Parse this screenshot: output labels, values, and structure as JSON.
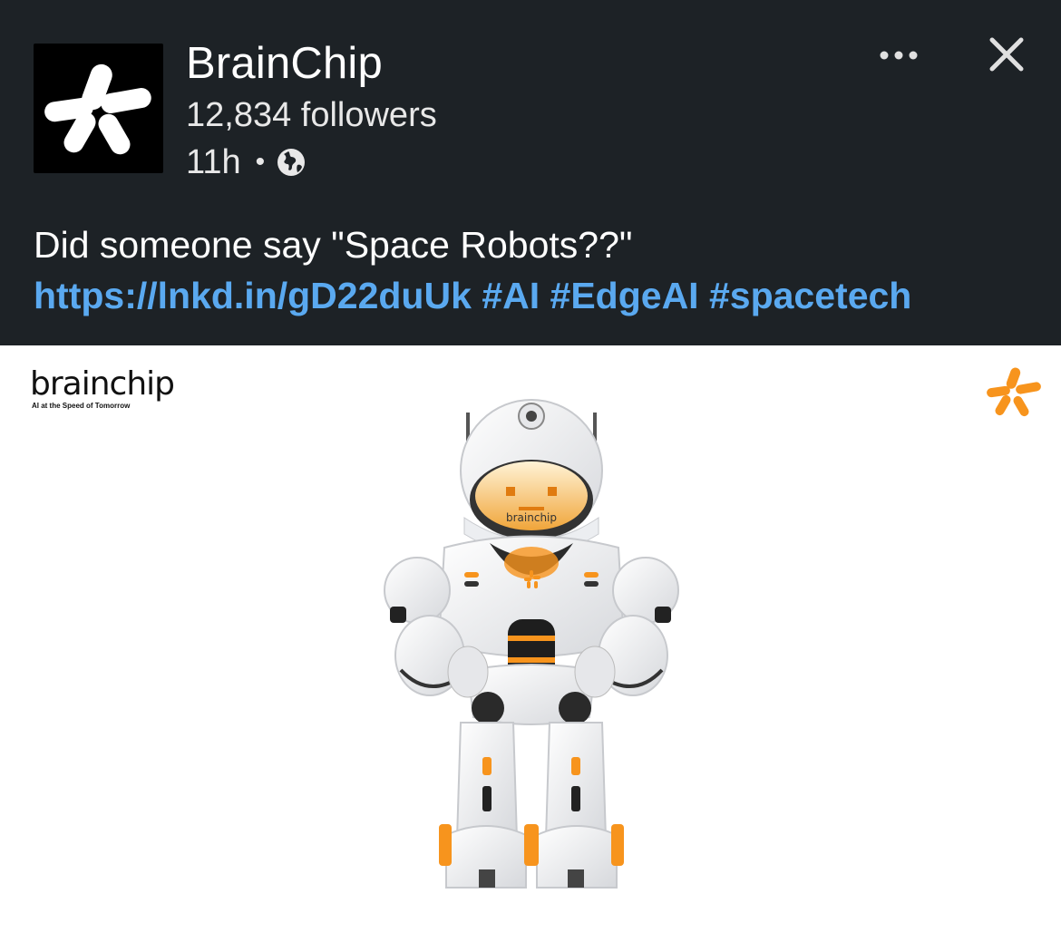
{
  "post": {
    "company_name": "BrainChip",
    "followers": "12,834 followers",
    "time": "11h",
    "separator": "•",
    "visibility_icon": "globe-icon",
    "more_icon": "more-horizontal-icon",
    "close_icon": "close-icon",
    "text_plain": "Did someone say \"Space Robots??\" ",
    "link": "https://lnkd.in/gD22duUk",
    "hashtags": [
      "#AI",
      "#EdgeAI",
      "#spacetech"
    ]
  },
  "media": {
    "brand_word": "brainchip",
    "brand_tagline": "AI at the Speed of Tomorrow",
    "robot_chest_label": "brainchip",
    "accent_color": "#f7941d",
    "description_icon": "brainchip-robot-illustration"
  },
  "colors": {
    "background": "#1d2226",
    "link": "#5aa9f0",
    "text": "#ffffff"
  }
}
